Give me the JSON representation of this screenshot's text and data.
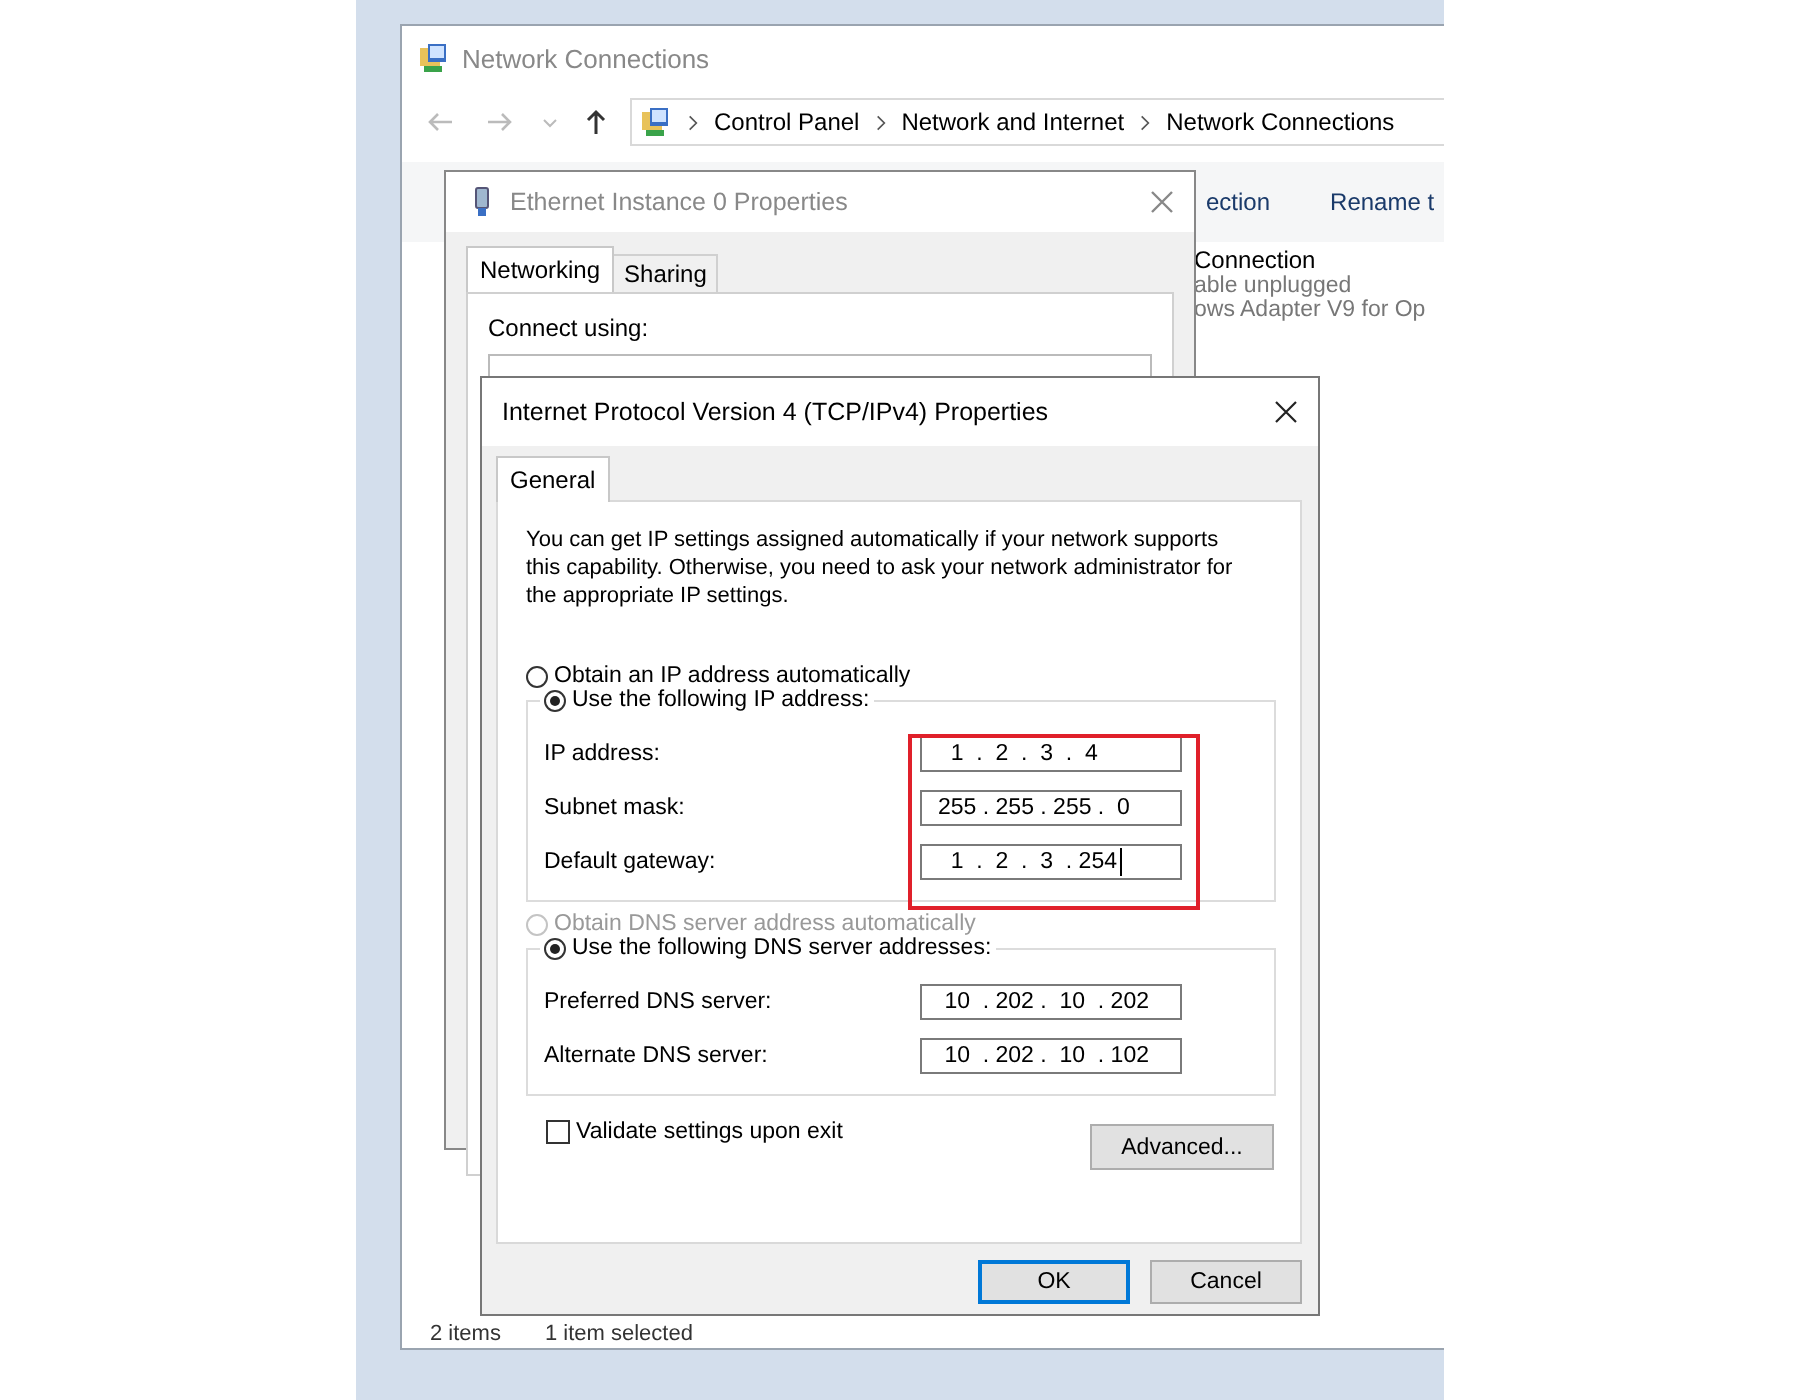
{
  "explorer": {
    "title": "Network Connections",
    "breadcrumb": [
      "Control Panel",
      "Network and Internet",
      "Network Connections"
    ],
    "toolbar": [
      "ection",
      "Rename t"
    ],
    "connection": {
      "name": "Connection",
      "status": "able unplugged",
      "device": "ows Adapter V9 for Op"
    },
    "status_bar": [
      "2 items",
      "1 item selected"
    ]
  },
  "ethernet_dialog": {
    "title": "Ethernet Instance 0 Properties",
    "tabs": [
      {
        "label": "Networking",
        "selected": true
      },
      {
        "label": "Sharing",
        "selected": false
      }
    ],
    "connect_using": "Connect using:"
  },
  "ipv4_dialog": {
    "title": "Internet Protocol Version 4 (TCP/IPv4) Properties",
    "tabs": [
      {
        "label": "General",
        "selected": true
      }
    ],
    "description": "You can get IP settings assigned automatically if your network supports this capability. Otherwise, you need to ask your network administrator for the appropriate IP settings.",
    "ip_mode": [
      {
        "label": "Obtain an IP address automatically",
        "selected": false,
        "disabled": false
      },
      {
        "label": "Use the following IP address:",
        "selected": true,
        "disabled": false
      }
    ],
    "ip_highlighted": true,
    "ip_fields": [
      {
        "label": "IP address:",
        "value": "  1  .  2  .  3  .  4",
        "focused": false
      },
      {
        "label": "Subnet mask:",
        "value": "255 . 255 . 255 .  0",
        "focused": false
      },
      {
        "label": "Default gateway:",
        "value": "  1  .  2  .  3  . 254",
        "focused": true
      }
    ],
    "dns_mode": [
      {
        "label": "Obtain DNS server address automatically",
        "selected": false,
        "disabled": true
      },
      {
        "label": "Use the following DNS server addresses:",
        "selected": true,
        "disabled": false
      }
    ],
    "dns_fields": [
      {
        "label": "Preferred DNS server:",
        "value": " 10  . 202 .  10  . 202",
        "focused": false
      },
      {
        "label": "Alternate DNS server:",
        "value": " 10  . 202 .  10  . 102",
        "focused": false
      }
    ],
    "validate": {
      "label": "Validate settings upon exit",
      "checked": false
    },
    "advanced_button": "Advanced...",
    "buttons": [
      {
        "label": "OK",
        "default": true
      },
      {
        "label": "Cancel",
        "default": false
      }
    ]
  }
}
